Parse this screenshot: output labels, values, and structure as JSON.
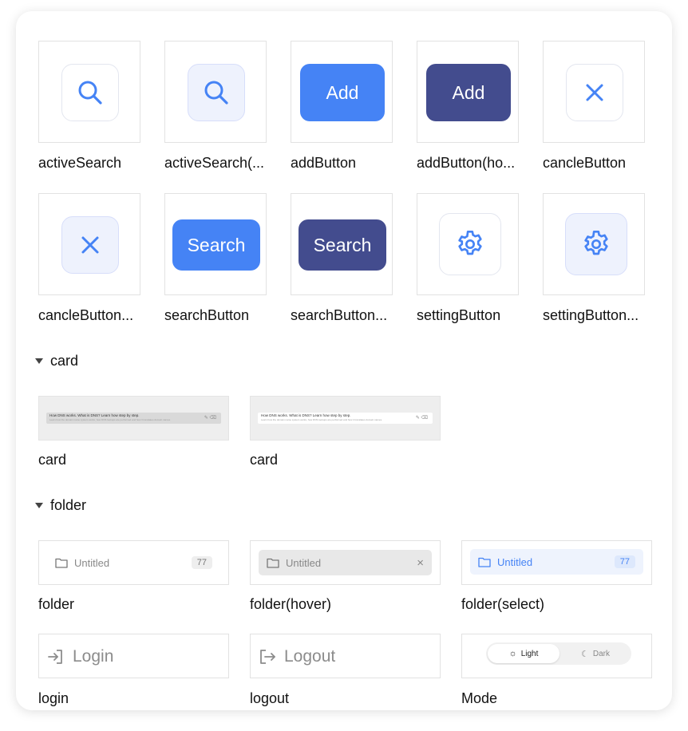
{
  "colors": {
    "accent_blue": "#4583f5",
    "navy": "#434c8e",
    "hover_bg": "#eef2fd",
    "select_bg": "#eef3fd"
  },
  "buttons_grid": {
    "row1": [
      {
        "label": "activeSearch",
        "icon": "search-icon"
      },
      {
        "label": "activeSearch(...",
        "icon": "search-icon"
      },
      {
        "label": "addButton",
        "button_text": "Add"
      },
      {
        "label": "addButton(ho...",
        "button_text": "Add"
      },
      {
        "label": "cancleButton",
        "icon": "close-icon"
      }
    ],
    "row2": [
      {
        "label": "cancleButton...",
        "icon": "close-icon"
      },
      {
        "label": "searchButton",
        "button_text": "Search"
      },
      {
        "label": "searchButton...",
        "button_text": "Search"
      },
      {
        "label": "settingButton",
        "icon": "gear-icon"
      },
      {
        "label": "settingButton...",
        "icon": "gear-icon"
      }
    ]
  },
  "sections": {
    "card": {
      "title": "card",
      "items": [
        {
          "label": "card",
          "line1": "How DNS works. What is DNS? Learn how step by step.",
          "line2": "Learn how the domain name system works, how DNS lookups are performed and how it translates domain names."
        },
        {
          "label": "card",
          "line1": "How DNS works. What is DNS? Learn how step by step.",
          "line2": "Learn how the domain name system works, how DNS lookups are performed and how it translates domain names."
        }
      ]
    },
    "folder": {
      "title": "folder",
      "items": [
        {
          "label": "folder",
          "name": "Untitled",
          "count": "77"
        },
        {
          "label": "folder(hover)",
          "name": "Untitled",
          "close": "×"
        },
        {
          "label": "folder(select)",
          "name": "Untitled",
          "count": "77"
        }
      ]
    }
  },
  "auth": {
    "login": {
      "label": "login",
      "text": "Login"
    },
    "logout": {
      "label": "logout",
      "text": "Logout"
    },
    "mode": {
      "label": "Mode",
      "light": "Light",
      "dark": "Dark"
    }
  }
}
